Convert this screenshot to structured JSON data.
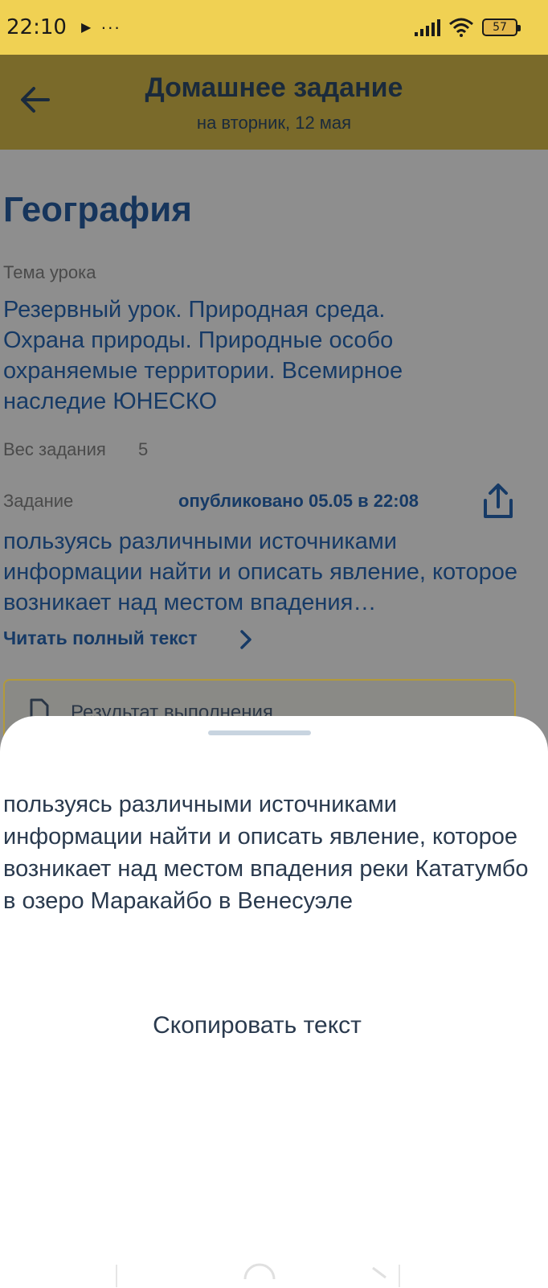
{
  "status": {
    "time": "22:10",
    "play": "▶",
    "dots": "···",
    "battery": "57"
  },
  "header": {
    "title": "Домашнее задание",
    "subtitle": "на вторник, 12 мая"
  },
  "lesson": {
    "subject": "География",
    "topic_label": "Тема урока",
    "topic": "Резервный урок. Природная среда. Охрана природы. Природные особо охраняемые территории. Всемирное наследие ЮНЕСКО",
    "weight_label": "Вес задания",
    "weight_value": "5",
    "task_label": "Задание",
    "published": "опубликовано 05.05 в 22:08",
    "task_preview": "пользуясь различными источниками информации найти и описать явление, которое возникает над местом впадения…",
    "read_more": "Читать полный текст",
    "result_label": "Результат выполнения"
  },
  "sheet": {
    "full_text": "пользуясь различными источниками информации найти и описать явление, которое возникает над местом впадения реки Кататумбо в озеро Маракайбо в Венесуэле",
    "copy_button": "Скопировать текст"
  },
  "colors": {
    "status_bar": "#f0d153",
    "header_dimmed": "#7a6a2a",
    "overlay": "#8e8e8e",
    "primary_text": "#163a66"
  }
}
